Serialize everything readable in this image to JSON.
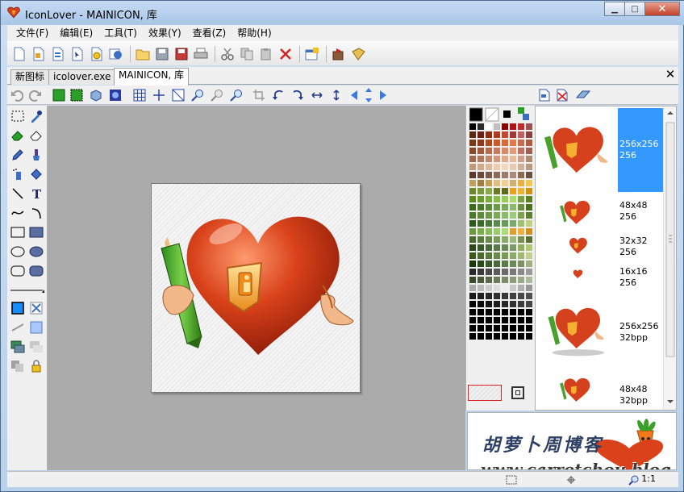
{
  "window": {
    "title": "IconLover - MAINICON, 库",
    "min_label": "▁",
    "max_label": "□",
    "close_label": "✕"
  },
  "menu": {
    "items": [
      "文件(F)",
      "编辑(E)",
      "工具(T)",
      "效果(Y)",
      "查看(Z)",
      "帮助(H)"
    ]
  },
  "tabs": {
    "items": [
      {
        "label": "新图标",
        "active": false
      },
      {
        "label": "icolover.exe",
        "active": false
      },
      {
        "label": "MAINICON, 库",
        "active": true
      }
    ],
    "close_label": "✕"
  },
  "image_list": {
    "entries": [
      {
        "size": "256x256",
        "depth": "256",
        "selected": true
      },
      {
        "size": "48x48",
        "depth": "256",
        "selected": false
      },
      {
        "size": "32x32",
        "depth": "256",
        "selected": false
      },
      {
        "size": "16x16",
        "depth": "256",
        "selected": false
      },
      {
        "size": "256x256",
        "depth": "32bpp",
        "selected": false
      },
      {
        "size": "48x48",
        "depth": "32bpp",
        "selected": false
      }
    ]
  },
  "preview": {
    "watermark_cn": "胡萝卜周博客",
    "watermark_url": "www.carrotchou.blog"
  },
  "status": {
    "zoom": "1:1"
  },
  "colors": {
    "accent": "#3399ff",
    "heart": "#d4411c",
    "canvas_bg": "#ababab"
  },
  "icons": {
    "toolbar": [
      "new-icon",
      "new-image-icon",
      "new-library-icon",
      "new-cursor-icon",
      "new-animated-cursor-icon",
      "new-project-icon",
      "open-icon",
      "save-icon",
      "save-all-icon",
      "print-icon",
      "cut-icon",
      "copy-icon",
      "paste-icon",
      "delete-icon",
      "properties-icon",
      "extract-icon",
      "library-icon"
    ]
  }
}
